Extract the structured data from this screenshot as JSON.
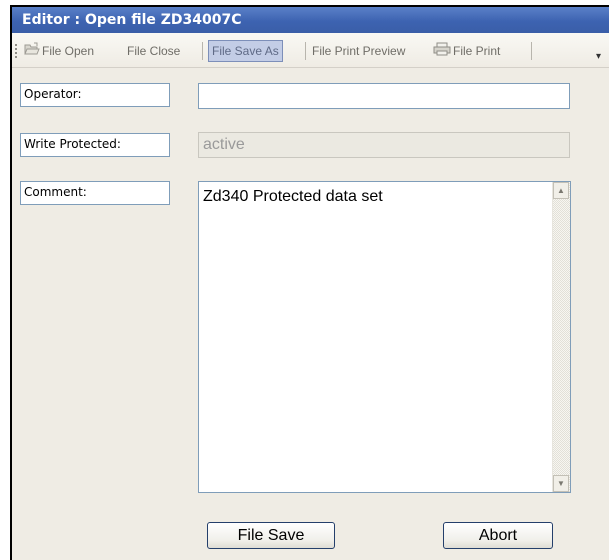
{
  "window": {
    "title": "Editor : Open file ZD34007C"
  },
  "toolbar": {
    "file_open": "File Open",
    "file_close": "File Close",
    "file_save_as": "File Save As",
    "file_print_preview": "File Print Preview",
    "file_print": "File Print",
    "overflow_glyph": "▾"
  },
  "form": {
    "operator_label": "Operator:",
    "operator_value": "",
    "write_protected_label": "Write Protected:",
    "write_protected_value": "active",
    "comment_label": "Comment:",
    "comment_value": "Zd340 Protected data set"
  },
  "scrollbar": {
    "up_glyph": "▲",
    "down_glyph": "▼"
  },
  "buttons": {
    "file_save": "File Save",
    "abort": "Abort"
  }
}
